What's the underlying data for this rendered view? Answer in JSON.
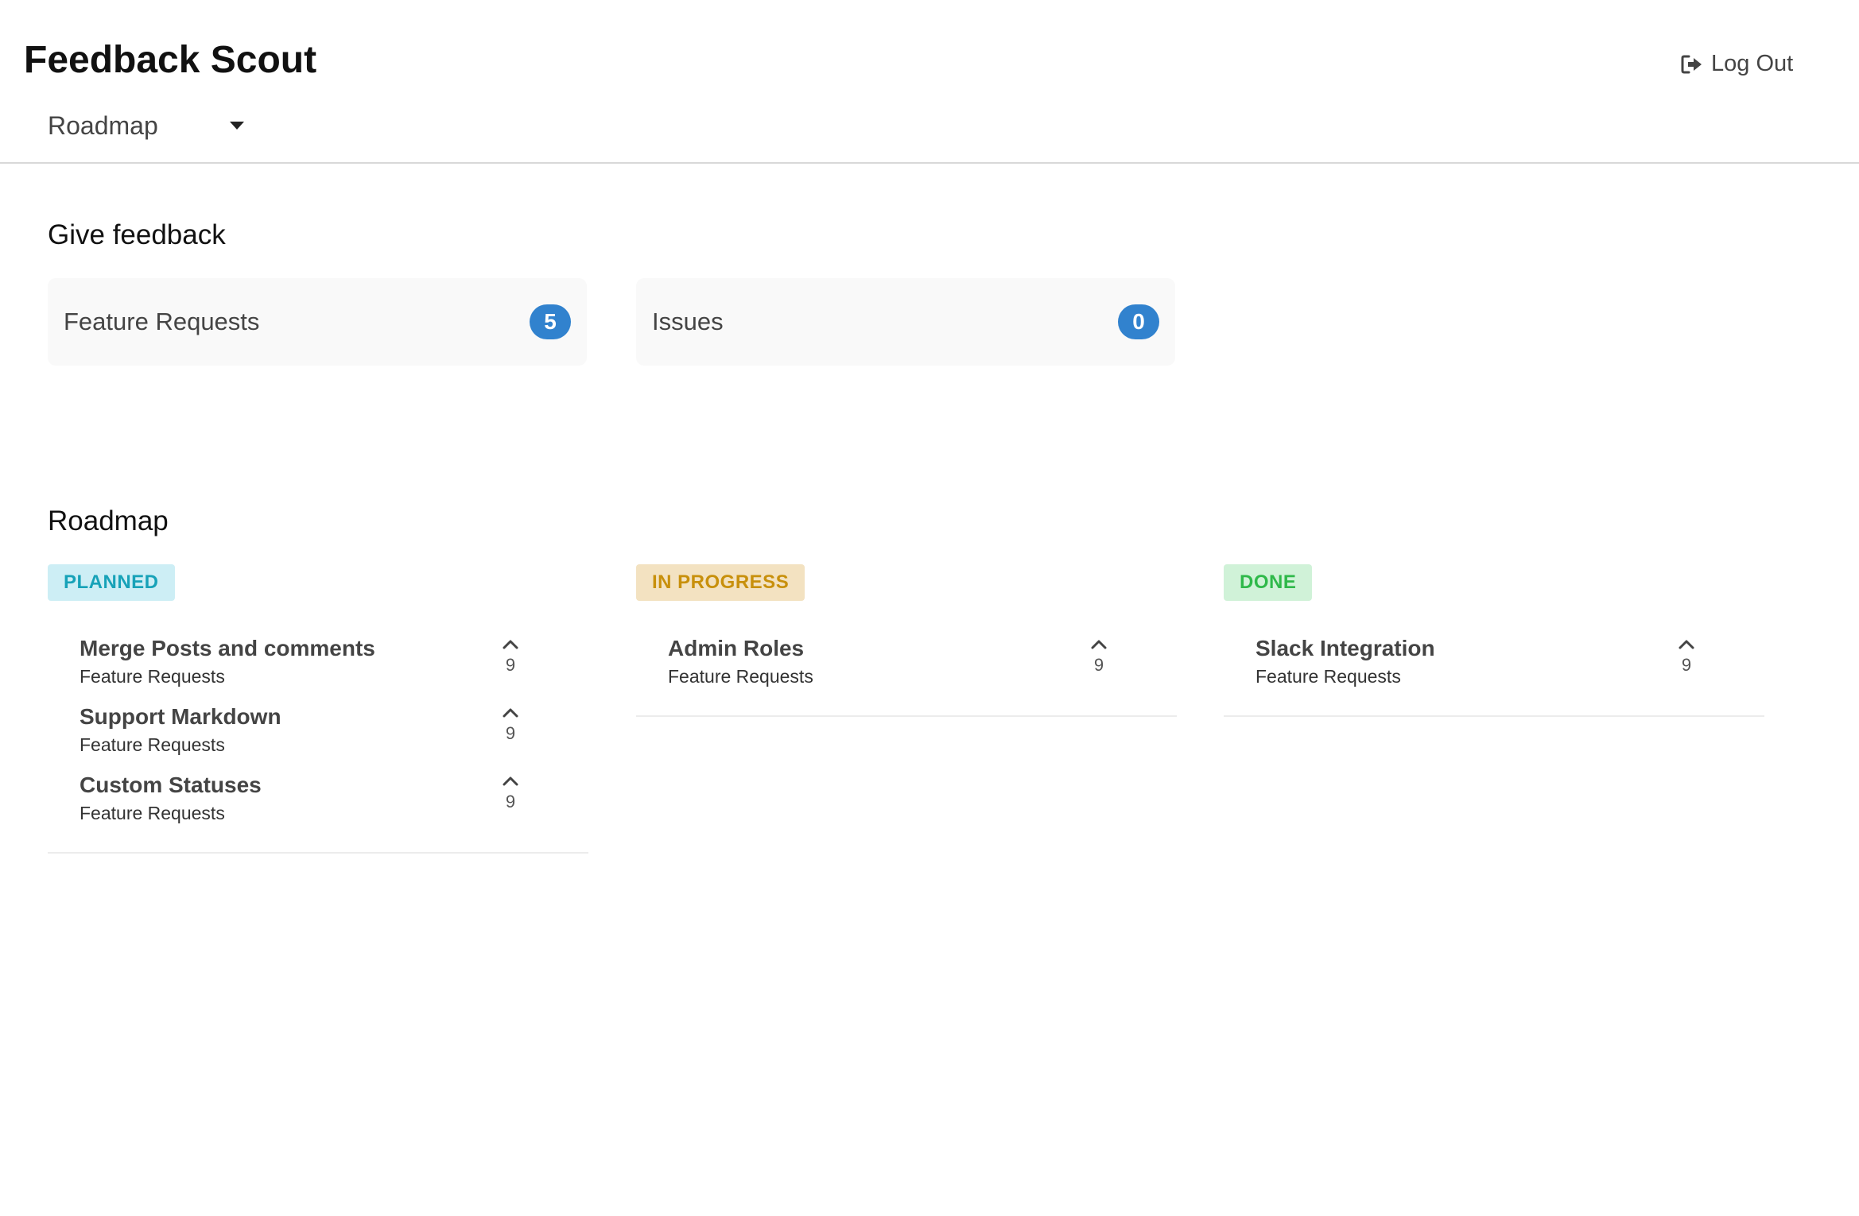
{
  "header": {
    "app_title": "Feedback Scout",
    "logout_label": "Log Out",
    "logout_icon": "sign-out-icon",
    "nav_selected": "Roadmap"
  },
  "feedback": {
    "title": "Give feedback",
    "boards": [
      {
        "label": "Feature Requests",
        "count": "5"
      },
      {
        "label": "Issues",
        "count": "0"
      }
    ]
  },
  "roadmap": {
    "title": "Roadmap",
    "columns": [
      {
        "status": "PLANNED",
        "status_color": "#17a2b8",
        "status_bg": "#cdeef5",
        "items": [
          {
            "title": "Merge Posts and comments",
            "board": "Feature Requests",
            "votes": "9"
          },
          {
            "title": "Support Markdown",
            "board": "Feature Requests",
            "votes": "9"
          },
          {
            "title": "Custom Statuses",
            "board": "Feature Requests",
            "votes": "9"
          }
        ]
      },
      {
        "status": "IN PROGRESS",
        "status_color": "#c8900c",
        "status_bg": "#f3e2c1",
        "items": [
          {
            "title": "Admin Roles",
            "board": "Feature Requests",
            "votes": "9"
          }
        ]
      },
      {
        "status": "DONE",
        "status_color": "#2fb94a",
        "status_bg": "#d0f2d8",
        "items": [
          {
            "title": "Slack Integration",
            "board": "Feature Requests",
            "votes": "9"
          }
        ]
      }
    ]
  },
  "colors": {
    "badge": "#3182ce",
    "divider": "#d8d8d8"
  }
}
